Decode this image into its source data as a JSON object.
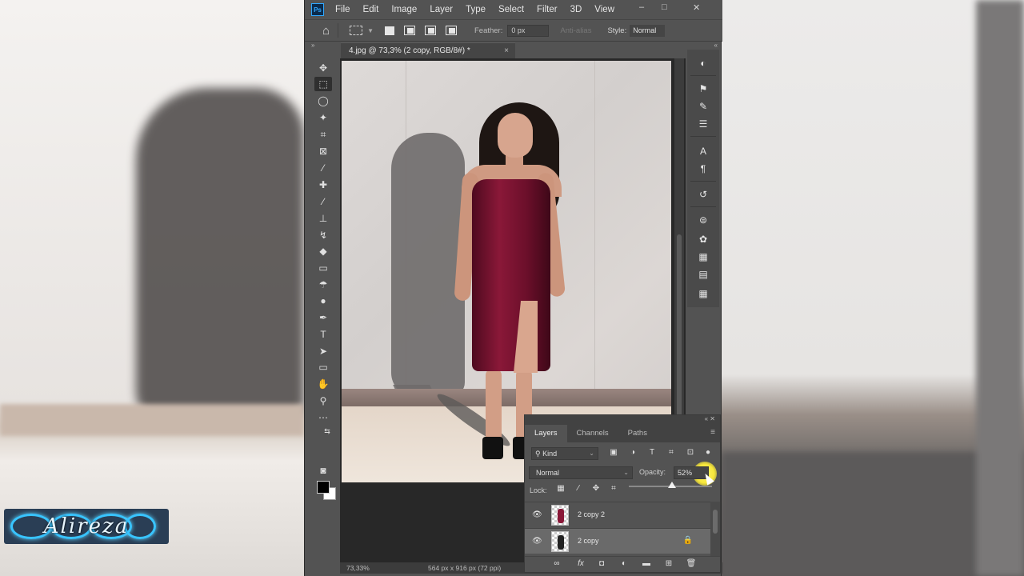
{
  "app": {
    "menu": [
      "File",
      "Edit",
      "Image",
      "Layer",
      "Type",
      "Select",
      "Filter",
      "3D",
      "View"
    ],
    "ps_badge": "Ps",
    "window_controls": [
      "–",
      "□",
      "✕"
    ]
  },
  "options_bar": {
    "feather_label": "Feather:",
    "feather_value": "0 px",
    "antialias_label": "Anti-alias",
    "style_label": "Style:",
    "style_value": "Normal"
  },
  "document": {
    "tab_title": "4.jpg @ 73,3% (2 copy, RGB/8#) *",
    "tab_close": "×"
  },
  "status": {
    "zoom": "73,33%",
    "dimensions": "564 px x 916 px (72 ppi)"
  },
  "layers_panel": {
    "tabs": [
      "Layers",
      "Channels",
      "Paths"
    ],
    "active_tab": "Layers",
    "kind_filter": "Kind",
    "blend_mode": "Normal",
    "opacity_label": "Opacity:",
    "opacity_value": "52%",
    "opacity_fraction": 0.52,
    "lock_label": "Lock:",
    "layers": [
      {
        "name": "2 copy 2",
        "visible": true,
        "selected": false,
        "locked": false
      },
      {
        "name": "2 copy",
        "visible": true,
        "selected": true,
        "locked": true
      }
    ]
  },
  "watermark": {
    "text": "Alireza"
  },
  "icons": {
    "eye": "eye-icon",
    "lock": "lock-icon",
    "fx": "fx"
  }
}
